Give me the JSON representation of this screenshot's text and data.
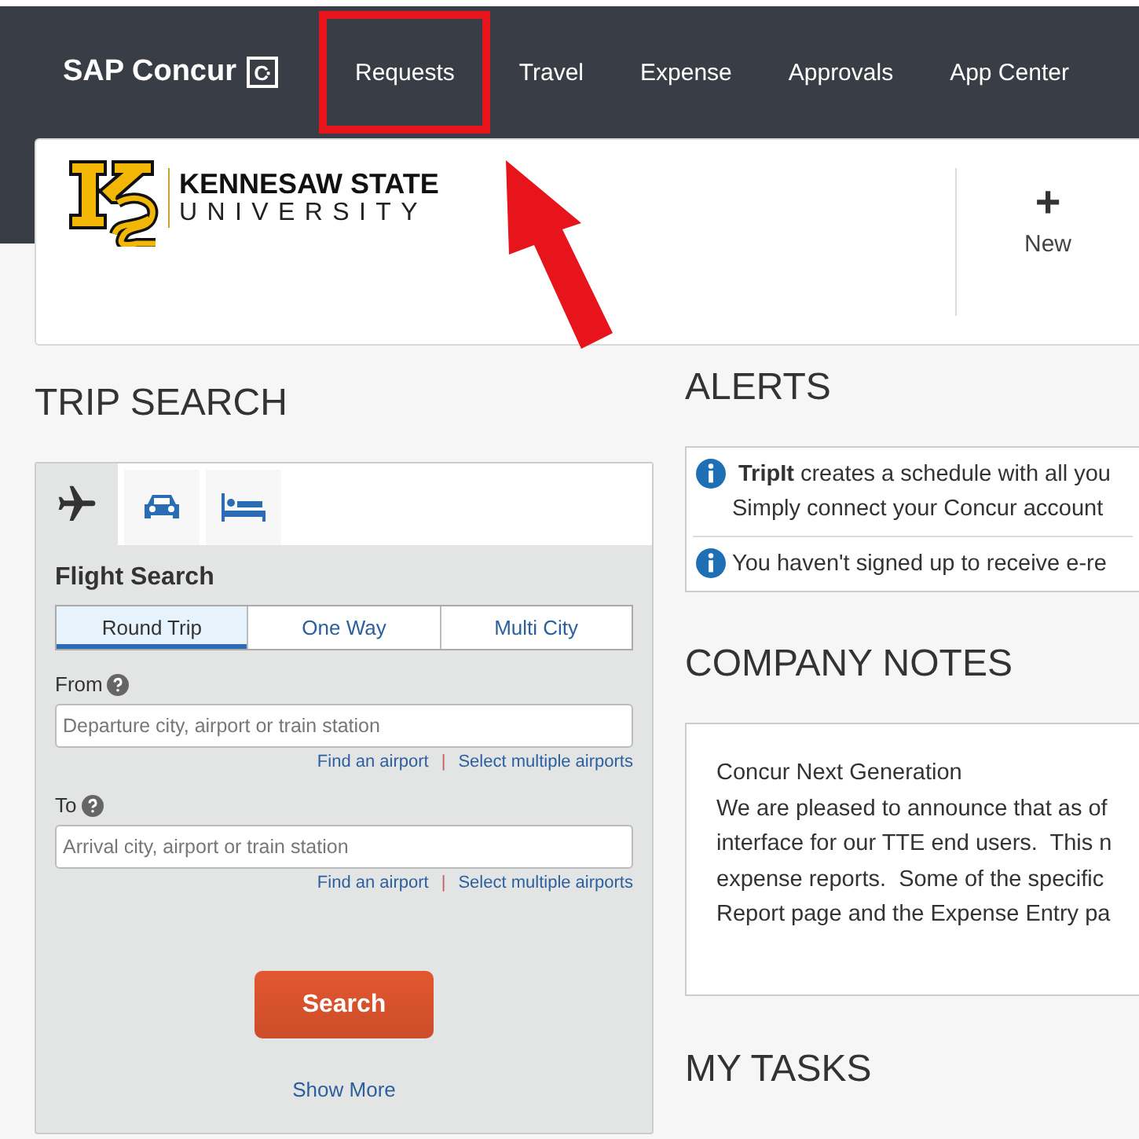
{
  "nav": {
    "brand": "SAP Concur",
    "brand_mark": "C·",
    "items": [
      {
        "label": "Requests",
        "highlighted": true
      },
      {
        "label": "Travel",
        "highlighted": false
      },
      {
        "label": "Expense",
        "highlighted": false
      },
      {
        "label": "Approvals",
        "highlighted": false
      },
      {
        "label": "App Center",
        "highlighted": false
      }
    ]
  },
  "banner": {
    "org_line1": "KENNESAW STATE",
    "org_line2": "UNIVERSITY",
    "new_icon": "+",
    "new_label": "New"
  },
  "trip_search": {
    "heading": "TRIP SEARCH",
    "tabs": [
      {
        "kind": "flight",
        "selected": true
      },
      {
        "kind": "car",
        "selected": false
      },
      {
        "kind": "hotel",
        "selected": false
      }
    ],
    "title": "Flight Search",
    "trip_types": [
      {
        "label": "Round Trip",
        "selected": true
      },
      {
        "label": "One Way",
        "selected": false
      },
      {
        "label": "Multi City",
        "selected": false
      }
    ],
    "fields": [
      {
        "label": "From",
        "placeholder": "Departure city, airport or train station",
        "links": [
          "Find an airport",
          "Select multiple airports"
        ],
        "separator": "|"
      },
      {
        "label": "To",
        "placeholder": "Arrival city, airport or train station",
        "links": [
          "Find an airport",
          "Select multiple airports"
        ],
        "separator": "|"
      }
    ],
    "search_button": "Search",
    "show_more": "Show More"
  },
  "alerts": {
    "heading": "ALERTS",
    "items": [
      {
        "lines": [
          "**TripIt** creates a schedule with all you",
          "Simply connect your Concur account"
        ]
      },
      {
        "lines": [
          "You haven't signed up to receive e-re"
        ]
      }
    ]
  },
  "company_notes": {
    "heading": "COMPANY NOTES",
    "title": "Concur Next Generation",
    "lines": [
      "We are pleased to announce that as of",
      "interface for our TTE end users.  This n",
      "expense reports.  Some of the specific",
      "Report page and the Expense Entry pa"
    ]
  },
  "my_tasks": {
    "heading": "MY TASKS"
  }
}
